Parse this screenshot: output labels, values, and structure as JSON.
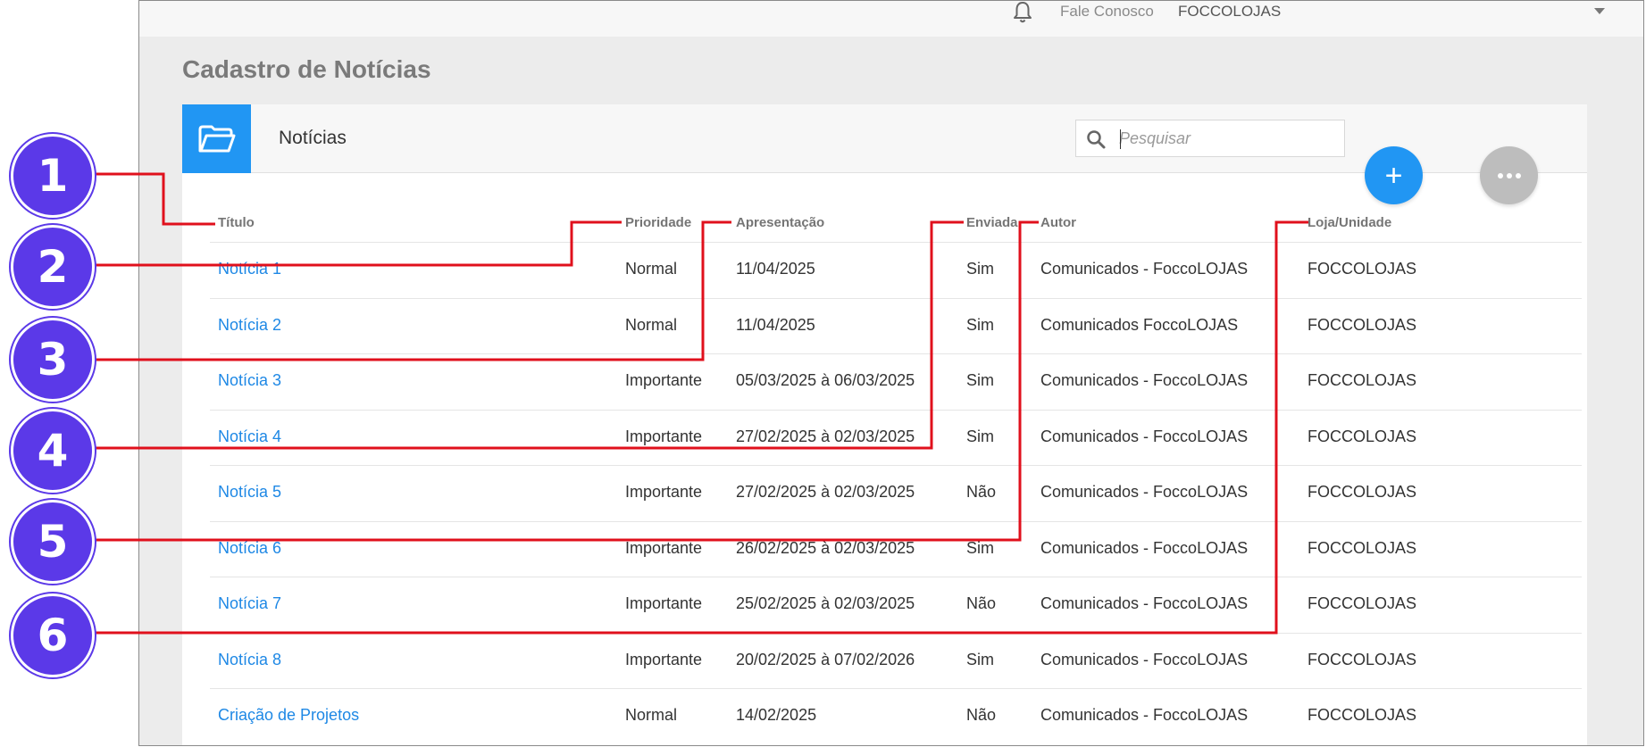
{
  "topbar": {
    "fale_conosco": "Fale Conosco",
    "brand": "FOCCOLOJAS"
  },
  "page_title": "Cadastro de Notícias",
  "card": {
    "title": "Notícias",
    "search_placeholder": "Pesquisar",
    "add_label": "+"
  },
  "table": {
    "headers": [
      "Título",
      "Prioridade",
      "Apresentação",
      "Enviada",
      "Autor",
      "Loja/Unidade"
    ],
    "rows": [
      [
        "Notícia 1",
        "Normal",
        "11/04/2025",
        "Sim",
        "Comunicados - FoccoLOJAS",
        "FOCCOLOJAS"
      ],
      [
        "Notícia 2",
        "Normal",
        "11/04/2025",
        "Sim",
        "Comunicados   FoccoLOJAS",
        "FOCCOLOJAS"
      ],
      [
        "Notícia 3",
        "Importante",
        "05/03/2025 à 06/03/2025",
        "Sim",
        "Comunicados - FoccoLOJAS",
        "FOCCOLOJAS"
      ],
      [
        "Notícia 4",
        "Importante",
        "27/02/2025 à 02/03/2025",
        "Sim",
        "Comunicados - FoccoLOJAS",
        "FOCCOLOJAS"
      ],
      [
        "Notícia 5",
        "Importante",
        "27/02/2025 à 02/03/2025",
        "Não",
        "Comunicados - FoccoLOJAS",
        "FOCCOLOJAS"
      ],
      [
        "Notícia 6",
        "Importante",
        "26/02/2025 à 02/03/2025",
        "Sim",
        "Comunicados - FoccoLOJAS",
        "FOCCOLOJAS"
      ],
      [
        "Notícia 7",
        "Importante",
        "25/02/2025 à 02/03/2025",
        "Não",
        "Comunicados - FoccoLOJAS",
        "FOCCOLOJAS"
      ],
      [
        "Notícia 8",
        "Importante",
        "20/02/2025 à 07/02/2026",
        "Sim",
        "Comunicados - FoccoLOJAS",
        "FOCCOLOJAS"
      ],
      [
        "Criação de Projetos",
        "Normal",
        "14/02/2025",
        "Não",
        "Comunicados - FoccoLOJAS",
        "FOCCOLOJAS"
      ]
    ]
  },
  "annotations": [
    "1",
    "2",
    "3",
    "4",
    "5",
    "6"
  ],
  "colors": {
    "accent": "#2196f3",
    "link": "#1e88e5",
    "badge": "#5b39e8",
    "callout_line": "#e0101c"
  },
  "icons": {
    "bell": "bell-icon",
    "folder": "folder-open-icon",
    "search": "search-icon",
    "more": "more-horizontal-icon",
    "caret": "caret-down-icon"
  }
}
